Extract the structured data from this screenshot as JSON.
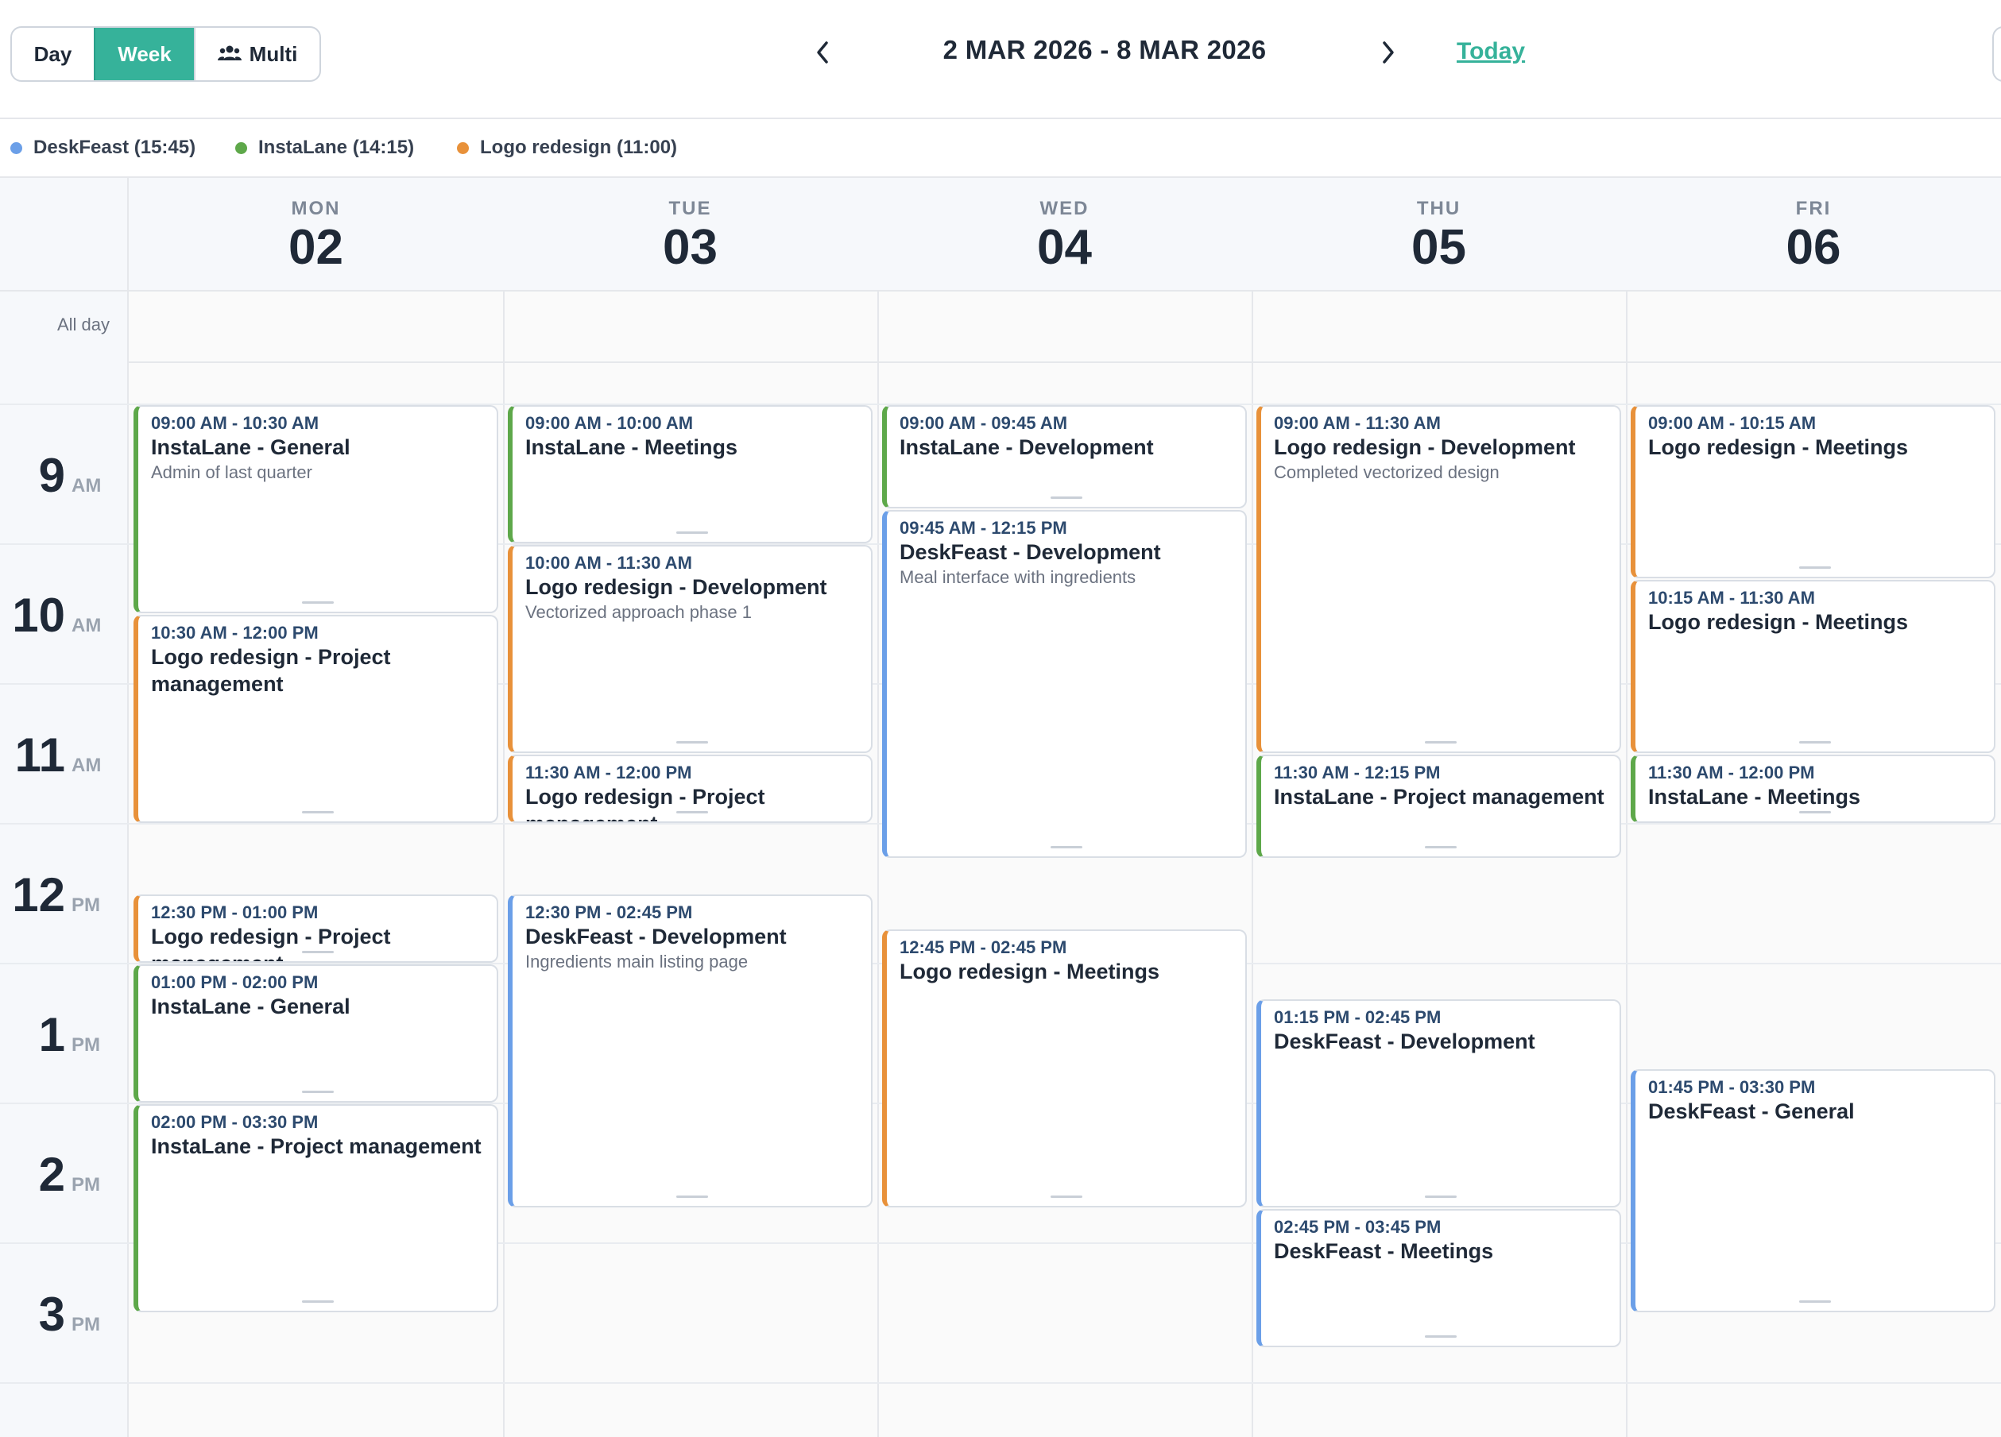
{
  "toolbar": {
    "day_label": "Day",
    "week_label": "Week",
    "multi_label": "Multi",
    "date_range": "2 MAR 2026 - 8 MAR 2026",
    "today_label": "Today"
  },
  "colors": {
    "accent": "#36b29a",
    "deskfeast": "#6b9fe8",
    "instalane": "#5ea84a",
    "logo_redesign": "#e8913a"
  },
  "legend": [
    {
      "label": "DeskFeast (15:45)",
      "color": "#6b9fe8"
    },
    {
      "label": "InstaLane (14:15)",
      "color": "#5ea84a"
    },
    {
      "label": "Logo redesign (11:00)",
      "color": "#e8913a"
    }
  ],
  "days": [
    {
      "name": "MON",
      "num": "02"
    },
    {
      "name": "TUE",
      "num": "03"
    },
    {
      "name": "WED",
      "num": "04"
    },
    {
      "name": "THU",
      "num": "05"
    },
    {
      "name": "FRI",
      "num": "06"
    }
  ],
  "all_day_label": "All day",
  "hours": [
    {
      "num": "9",
      "ampm": "AM"
    },
    {
      "num": "10",
      "ampm": "AM"
    },
    {
      "num": "11",
      "ampm": "AM"
    },
    {
      "num": "12",
      "ampm": "PM"
    },
    {
      "num": "1",
      "ampm": "PM"
    },
    {
      "num": "2",
      "ampm": "PM"
    },
    {
      "num": "3",
      "ampm": "PM"
    }
  ],
  "events": [
    {
      "day": 0,
      "start": "09:00",
      "end": "10:30",
      "project": "instalane",
      "time": "09:00 AM - 10:30 AM",
      "title": "InstaLane - General",
      "desc": "Admin of last quarter"
    },
    {
      "day": 0,
      "start": "10:30",
      "end": "12:00",
      "project": "logo_redesign",
      "time": "10:30 AM - 12:00 PM",
      "title": "Logo redesign - Project management",
      "desc": ""
    },
    {
      "day": 0,
      "start": "12:30",
      "end": "13:00",
      "project": "logo_redesign",
      "time": "12:30 PM - 01:00 PM",
      "title": "Logo redesign - Project management",
      "desc": ""
    },
    {
      "day": 0,
      "start": "13:00",
      "end": "14:00",
      "project": "instalane",
      "time": "01:00 PM - 02:00 PM",
      "title": "InstaLane - General",
      "desc": ""
    },
    {
      "day": 0,
      "start": "14:00",
      "end": "15:30",
      "project": "instalane",
      "time": "02:00 PM - 03:30 PM",
      "title": "InstaLane - Project management",
      "desc": ""
    },
    {
      "day": 1,
      "start": "09:00",
      "end": "10:00",
      "project": "instalane",
      "time": "09:00 AM - 10:00 AM",
      "title": "InstaLane - Meetings",
      "desc": ""
    },
    {
      "day": 1,
      "start": "10:00",
      "end": "11:30",
      "project": "logo_redesign",
      "time": "10:00 AM - 11:30 AM",
      "title": "Logo redesign - Development",
      "desc": "Vectorized approach phase 1"
    },
    {
      "day": 1,
      "start": "11:30",
      "end": "12:00",
      "project": "logo_redesign",
      "time": "11:30 AM - 12:00 PM",
      "title": "Logo redesign - Project management",
      "desc": ""
    },
    {
      "day": 1,
      "start": "12:30",
      "end": "14:45",
      "project": "deskfeast",
      "time": "12:30 PM - 02:45 PM",
      "title": "DeskFeast - Development",
      "desc": "Ingredients main listing page"
    },
    {
      "day": 2,
      "start": "09:00",
      "end": "09:45",
      "project": "instalane",
      "time": "09:00 AM - 09:45 AM",
      "title": "InstaLane - Development",
      "desc": ""
    },
    {
      "day": 2,
      "start": "09:45",
      "end": "12:15",
      "project": "deskfeast",
      "time": "09:45 AM - 12:15 PM",
      "title": "DeskFeast - Development",
      "desc": "Meal interface with ingredients"
    },
    {
      "day": 2,
      "start": "12:45",
      "end": "14:45",
      "project": "logo_redesign",
      "time": "12:45 PM - 02:45 PM",
      "title": "Logo redesign - Meetings",
      "desc": ""
    },
    {
      "day": 3,
      "start": "09:00",
      "end": "11:30",
      "project": "logo_redesign",
      "time": "09:00 AM - 11:30 AM",
      "title": "Logo redesign - Development",
      "desc": "Completed vectorized design"
    },
    {
      "day": 3,
      "start": "11:30",
      "end": "12:15",
      "project": "instalane",
      "time": "11:30 AM - 12:15 PM",
      "title": "InstaLane - Project management",
      "desc": ""
    },
    {
      "day": 3,
      "start": "13:15",
      "end": "14:45",
      "project": "deskfeast",
      "time": "01:15 PM - 02:45 PM",
      "title": "DeskFeast - Development",
      "desc": ""
    },
    {
      "day": 3,
      "start": "14:45",
      "end": "15:45",
      "project": "deskfeast",
      "time": "02:45 PM - 03:45 PM",
      "title": "DeskFeast - Meetings",
      "desc": ""
    },
    {
      "day": 4,
      "start": "09:00",
      "end": "10:15",
      "project": "logo_redesign",
      "time": "09:00 AM - 10:15 AM",
      "title": "Logo redesign - Meetings",
      "desc": ""
    },
    {
      "day": 4,
      "start": "10:15",
      "end": "11:30",
      "project": "logo_redesign",
      "time": "10:15 AM - 11:30 AM",
      "title": "Logo redesign - Meetings",
      "desc": ""
    },
    {
      "day": 4,
      "start": "11:30",
      "end": "12:00",
      "project": "instalane",
      "time": "11:30 AM - 12:00 PM",
      "title": "InstaLane - Meetings",
      "desc": ""
    },
    {
      "day": 4,
      "start": "13:45",
      "end": "15:30",
      "project": "deskfeast",
      "time": "01:45 PM - 03:30 PM",
      "title": "DeskFeast - General",
      "desc": ""
    }
  ]
}
